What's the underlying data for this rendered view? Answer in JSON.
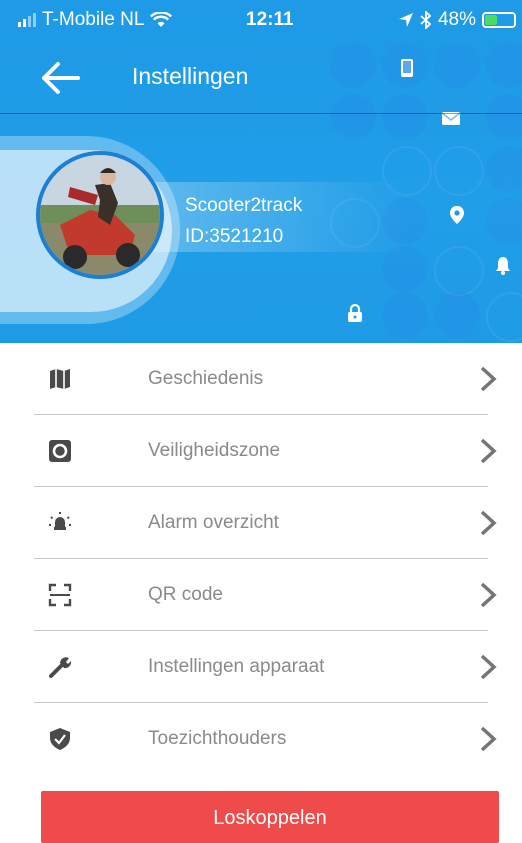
{
  "status_bar": {
    "carrier": "T-Mobile NL",
    "time": "12:11",
    "battery": "48%",
    "battery_level": 0.48,
    "battery_color": "#4cd964"
  },
  "header": {
    "title": "Instellingen",
    "back_icon": "arrow-left-icon",
    "background_color": "#1f9be6"
  },
  "device": {
    "name": "Scooter2track",
    "id": "ID:3521210"
  },
  "menu": {
    "items": [
      {
        "label": "Geschiedenis",
        "icon": "map-icon"
      },
      {
        "label": "Veiligheidszone",
        "icon": "safe-zone-icon"
      },
      {
        "label": "Alarm overzicht",
        "icon": "alarm-light-icon"
      },
      {
        "label": "QR code",
        "icon": "qr-scan-icon"
      },
      {
        "label": "Instellingen apparaat",
        "icon": "wrench-icon"
      },
      {
        "label": "Toezichthouders",
        "icon": "shield-check-icon"
      }
    ]
  },
  "actions": {
    "disconnect_label": "Loskoppelen",
    "disconnect_color": "#ef4b4b"
  }
}
